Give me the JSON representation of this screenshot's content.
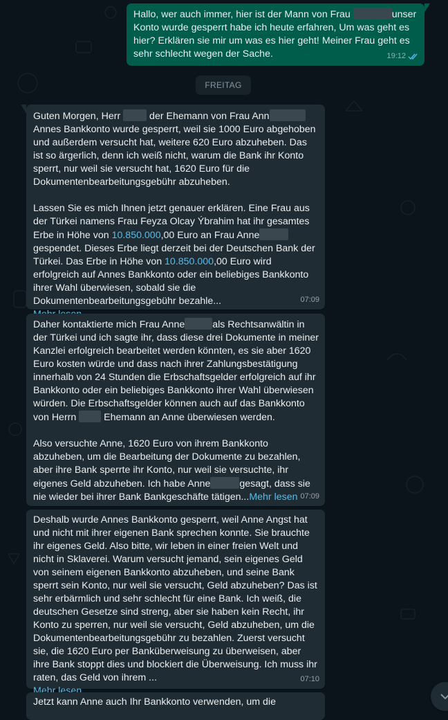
{
  "outgoing": {
    "parts": [
      "Hallo, wer auch immer, hier ist der Mann von Frau ",
      "unser Konto wurde gesperrt habe ich heute erfahren, Um was geht es hier? Erklären sie mir um was es hier geht! Meiner Frau geht es sehr schlecht wegen der Sache."
    ],
    "time": "19:12",
    "status_icon": "double-check-icon"
  },
  "date_separator": "FREITAG",
  "messages": [
    {
      "parts": [
        "Guten Morgen, Herr ",
        " der Ehemann von Frau Ann",
        "\nAnnes Bankkonto wurde gesperrt, weil sie 1000 Euro abgehoben und außerdem versucht hat, weitere 620 Euro abzuheben. Das ist so ärgerlich, denn ich weiß nicht, warum die Bank ihr Konto sperrt, nur weil sie versucht hat, 1620 Euro für die Dokumentenbearbeitungsgebühr abzuheben.\n\nLassen Sie es mich Ihnen jetzt genauer erklären. Eine Frau aus der Türkei namens Frau Feyza Olcay Ýbrahim hat ihr gesamtes Erbe in Höhe von ",
        "10.850.000",
        ",00 Euro an Frau Anne",
        "gespendet. Dieses Erbe liegt derzeit bei der Deutschen Bank der Türkei. Das Erbe in Höhe von ",
        "10.850.000",
        ",00 Euro wird erfolgreich auf Annes Bankkonto oder ein beliebiges Bankkonto ihrer Wahl überwiesen, sobald sie die Dokumentenbearbeitungsgebühr bezahle..."
      ],
      "read_more": "Mehr lesen",
      "time": "07:09"
    },
    {
      "parts": [
        "Daher kontaktierte mich Frau Anne",
        "als Rechtsanwältin in der Türkei und ich sagte ihr, dass diese drei Dokumente in meiner Kanzlei erfolgreich bearbeitet werden könnten, es sie aber 1620 Euro kosten würde und dass nach ihrer Zahlungsbestätigung innerhalb von 24 Stunden die Erbschaftsgelder erfolgreich auf ihr Bankkonto oder ein beliebiges Bankkonto ihrer Wahl überwiesen würden. Die Erbschaftsgelder können auch auf das Bankkonto von Herrn ",
        " Ehemann an Anne überwiesen werden.\n\nAlso versuchte Anne, 1620 Euro von ihrem Bankkonto abzuheben, um die Bearbeitung der Dokumente zu bezahlen, aber ihre Bank sperrte ihr Konto, nur weil sie versuchte, ihr eigenes Geld abzuheben. Ich habe Anne",
        "gesagt, dass sie nie wieder bei ihrer Bank Bankgeschäfte tätigen..."
      ],
      "read_more": "Mehr lesen",
      "time": "07:09"
    },
    {
      "parts": [
        "Deshalb wurde Annes Bankkonto gesperrt, weil Anne Angst hat und nicht mit ihrer eigenen Bank sprechen konnte. Sie brauchte ihr eigenes Geld. Also bitte, wir leben in einer freien Welt und nicht in Sklaverei. Warum versucht jemand, sein eigenes Geld von seinem eigenen Bankkonto abzuheben, und seine Bank sperrt sein Konto, nur weil sie versucht, Geld abzuheben? Das ist sehr erbärmlich und sehr schlecht für eine Bank. Ich weiß, die deutschen Gesetze sind streng, aber sie haben kein Recht, ihr Konto zu sperren, nur weil sie versucht, Geld abzuheben, um die Dokumentenbearbeitungsgebühr zu bezahlen. Zuerst versucht sie, die 1620 Euro per Banküberweisung zu überweisen, aber ihre Bank stoppt dies und blockiert die Überweisung. Ich muss ihr raten, das Geld von ihrem ..."
      ],
      "read_more": "Mehr lesen",
      "time": "07:10"
    },
    {
      "parts": [
        "Jetzt kann Anne auch Ihr Bankkonto verwenden, um die"
      ]
    }
  ],
  "scroll_down_icon": "chevron-down-icon"
}
